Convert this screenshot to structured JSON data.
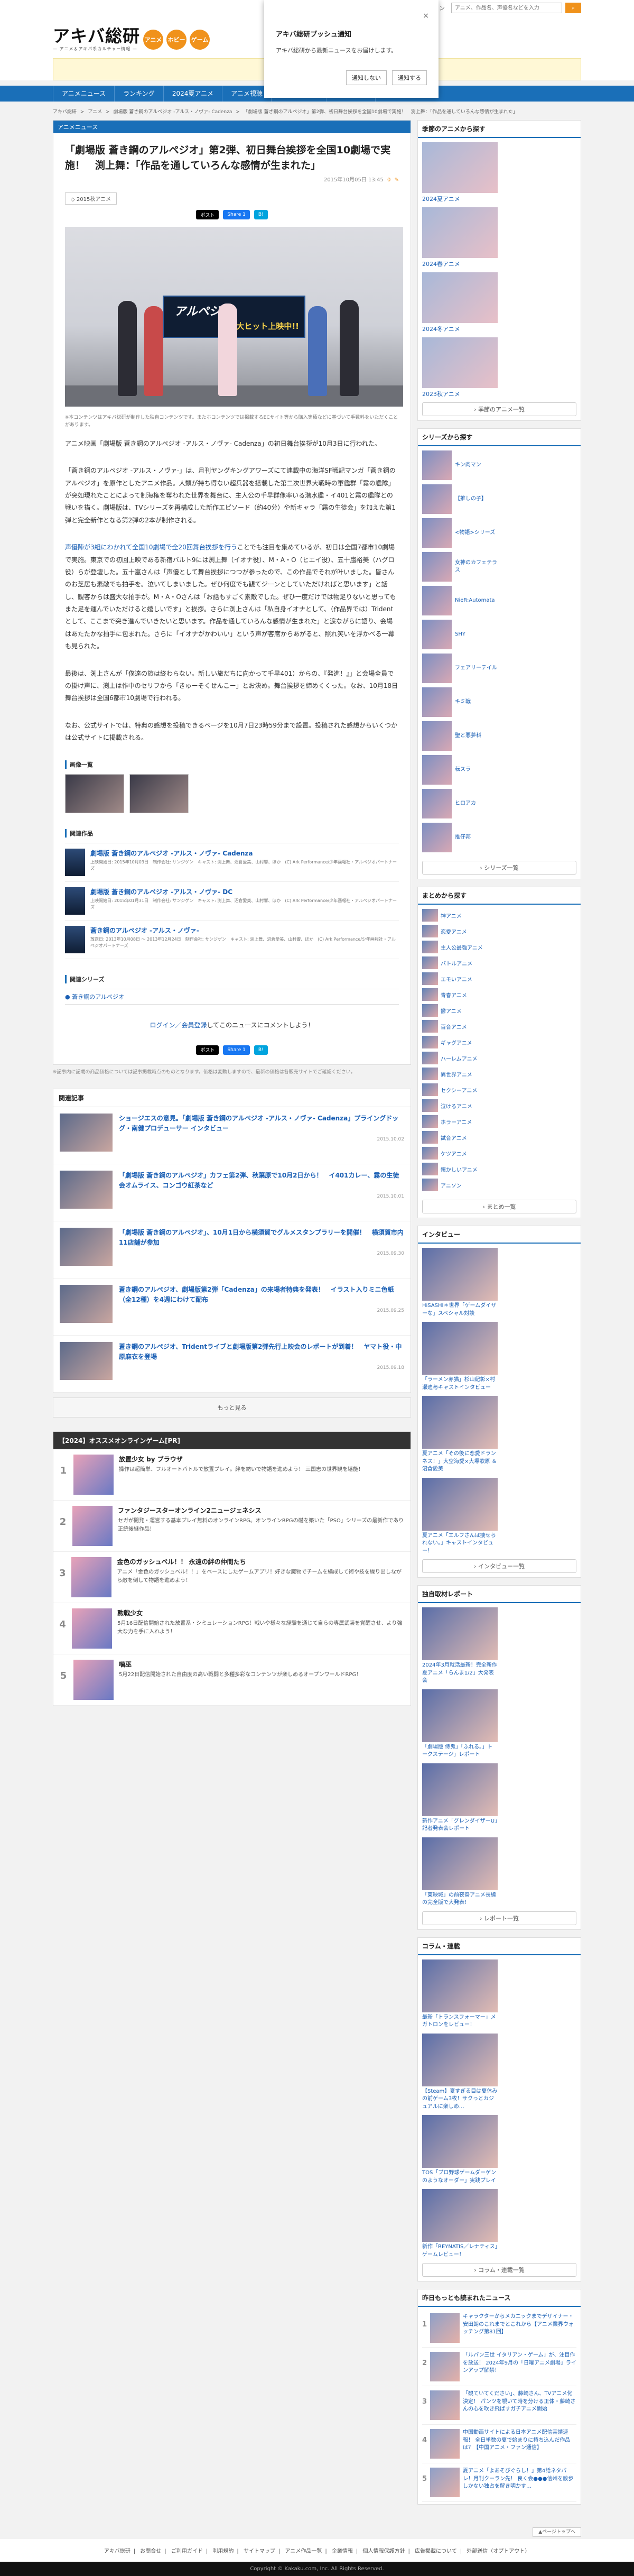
{
  "header": {
    "logo": "アキバ総研",
    "logo_sub": "— アニメ＆アキバ系カルチャー情報 —",
    "pills": [
      "アニメ",
      "ホビー",
      "ゲーム"
    ],
    "login": "ログイン",
    "search_placeholder": "アニメ、作品名、声優名などを入力",
    "search_button": "検索"
  },
  "push": {
    "title": "アキバ総研プッシュ通知",
    "body": "アキバ総研から最新ニュースをお届けします。",
    "deny": "通知しない",
    "allow": "通知する"
  },
  "nav": [
    "アニメニュース",
    "ランキング",
    "2024夏アニメ",
    "アニメ視聴",
    "声優ニュース",
    "アニメ映画"
  ],
  "breadcrumbs": [
    "アキバ総研",
    ">",
    "アニメ",
    ">",
    "劇場版 蒼き鋼のアルペジオ -アルス・ノヴァ- Cadenza",
    ">",
    "「劇場版 蒼き鋼のアルペジオ」第2弾、初日舞台挨拶を全国10劇場で実施！　渕上舞：「作品を通していろんな感情が生まれた」"
  ],
  "article": {
    "category": "アニメニュース",
    "title": "「劇場版 蒼き鋼のアルペジオ」第2弾、初日舞台挨拶を全国10劇場で実施！　渕上舞：「作品を通していろんな感情が生まれた」",
    "date": "2015年10月05日 13:45",
    "comments": "0",
    "tag": "2015秋アニメ",
    "share_x": "ポスト",
    "share_fb": "Share 1",
    "share_hb": "B!",
    "hero_logo": "アルペジオ",
    "hero_hit": "大ヒット上映中!!",
    "caption": "※本コンテンツはアキバ総研が制作した独自コンテンツです。またホコンテンツでは掲載するECサイト等から購入実績などに基づいて手数料をいただくことがあります。",
    "p1": "アニメ映画「劇場版 蒼き鋼のアルペジオ -アルス・ノヴァ- Cadenza」の初日舞台挨拶が10月3日に行われた。",
    "p2": "「蒼き鋼のアルペジオ -アルス・ノヴァ-」は、月刊ヤングキングアワーズにて連載中の海洋SF戦記マンガ「蒼き鋼のアルペジオ」を原作としたアニメ作品。人類が持ち得ない超兵器を搭載した第二次世界大戦時の軍艦群「霧の艦隊」が突如現れたことによって制海権を奪われた世界を舞台に、主人公の千早群像率いる潜水艦・イ401と霧の艦隊との戦いを描く。劇場版は、TVシリーズを再構成した新作エピソード（約40分）や新キャラ「霧の生徒会」を加えた第1弾と完全新作となる第2弾の2本が制作される。",
    "p3_link": "声優陣が3組にわかれて全国10劇場で全20回舞台挨拶を行う",
    "p3": "ことでも注目を集めているが、初日は全国7都市10劇場で実施。東京での初回上映である新宿バルト9には渕上舞（イオナ役）、M・A・O（ヒエイ役）、五十嵐裕美（ハグロ役）らが登壇した。五十嵐さんは「声優として舞台挨拶につつが参ったので、この作品でそれが叶いました。皆さんのお芝居も素敵でも拍手を。泣いてしまいました。ぜひ何度でも観てジーンとしていただければと思います」と話し、観客からは盛大な拍手が。M・A・Oさんは「お話もすごく素敵でした。ぜひ一度だけでは物足りないと思ってもまた足を運んでいただけると嬉しいです」と挨拶。さらに渕上さんは「私自身イオナとして、（作品界では）Tridentとして、ここまで突き進んでいきたいと思います。作品を通していろんな感情が生まれた」と涙ながらに語り、会場はあたたかな拍手に包まれた。さらに「イオナがかわいい」という声が客席からあがると、照れ笑いを浮かべる一幕も見られた。",
    "p4": "最後は、渕上さんが「僕達の旅は終わらない。新しい旅だちに向かって千早401）からの、『発進！』」と会場全員での掛け声に、渕上は作中のセリフから「きゅーそくせんこー」とお決め。舞台挨拶を締めくくった。なお、10月18日舞台挨拶は全国6都市10劇場で行われる。",
    "p5": "なお、公式サイトでは、特典の感想を投稿できるページを10月7日23時59分まで設置。投稿された感想からいくつかは公式サイトに掲載される。",
    "images_heading": "画像一覧",
    "works_heading": "関連作品",
    "works": [
      {
        "title": "劇場版 蒼き鋼のアルペジオ -アルス・ノヴァ- Cadenza",
        "meta": "上映開始日: 2015年10月03日　制作会社: サンジゲン　キャスト: 渕上舞、沼倉愛美、山村響、ほか　(C) Ark Performance/少年画報社・アルペジオパートナーズ"
      },
      {
        "title": "劇場版 蒼き鋼のアルペジオ -アルス・ノヴァ- DC",
        "meta": "上映開始日: 2015年01月31日　制作会社: サンジゲン　キャスト: 渕上舞、沼倉愛美、山村響、ほか　(C) Ark Performance/少年画報社・アルペジオパートナーズ"
      },
      {
        "title": "蒼き鋼のアルペジオ -アルス・ノヴァ-",
        "meta": "放送日: 2013年10月08日 ～ 2013年12月24日　制作会社: サンジゲン　キャスト: 渕上舞、沼倉愛美、山村響、ほか　(C) Ark Performance/少年画報社・アルペジオパートナーズ"
      }
    ],
    "series_heading": "関連シリーズ",
    "series_link": "蒼き鋼のアルペジオ",
    "login_link": "ログイン／会員登録",
    "login_rest": "してこのニュースにコメントしよう！",
    "foot_note": "※記事内に記載の商品価格については記事掲載時点のものとなります。価格は変動しますので、最新の価格は各販売サイトでご確認ください。"
  },
  "related": {
    "heading": "関連記事",
    "items": [
      {
        "title": "ショージエスの意見。「劇場版 蒼き鋼のアルペジオ -アルス・ノヴァ- Cadenza」プライングドッグ・南健プロデューサー インタビュー",
        "date": "2015.10.02"
      },
      {
        "title": "「劇場版 蒼き鋼のアルペジオ」カフェ第2弾、秋葉原で10月2日から！　イ401カレー、霧の生徒会オムライス、コンゴウ紅茶など",
        "date": "2015.10.01"
      },
      {
        "title": "「劇場版 蒼き鋼のアルペジオ」、10月1日から横須賀でグルメスタンプラリーを開催！　横須賀市内11店舗が参加",
        "date": "2015.09.30"
      },
      {
        "title": "蒼き鋼のアルペジオ、劇場版第2弾「Cadenza」の来場者特典を発表！　イラスト入りミニ色紙（全12種）を4週にわけて配布",
        "date": "2015.09.25"
      },
      {
        "title": "蒼き鋼のアルペジオ、Tridentライブと劇場版第2弾先行上映会のレポートが到着！　ヤマト役・中原麻衣を登場",
        "date": "2015.09.18"
      }
    ],
    "more": "もっと見る"
  },
  "games": {
    "heading": "【2024】オススメオンラインゲーム[PR]",
    "items": [
      {
        "num": "1",
        "name": "放置少女 by ブラウザ",
        "desc": "操作は超簡単、フルオートバトルで放置プレイ。絆を紡いで物語を進めよう！ 三国志の世界観を堪能！"
      },
      {
        "num": "2",
        "name": "ファンタジースターオンライン2ニュージェネシス",
        "desc": "セガが開発・運営する基本プレイ無料のオンラインRPG。オンラインRPGの礎を築いた「PSO」シリーズの最新作であり正統後継作品！"
      },
      {
        "num": "3",
        "name": "金色のガッシュベル！！ 永遠の絆の仲間たち",
        "desc": "アニメ「金色のガッシュベル！！」をベースにしたゲームアプリ！好きな魔物でチームを編成して術や技を繰り出しながら敵を倒して物語を進めよう！"
      },
      {
        "num": "4",
        "name": "勲戦少女",
        "desc": "5月16日配信開始された放置系・シミュレーションRPG！戦いや様々な経験を通じて自らの専属武装を覚醒させ、より強大な力を手に入れよう！"
      },
      {
        "num": "5",
        "name": "噛巫",
        "desc": "5月22日配信開始された自由度の高い戦闘と多種多彩なコンテンツが楽しめるオープンワールドRPG！"
      }
    ]
  },
  "sidebar": {
    "season": {
      "heading": "季節のアニメから探す",
      "items": [
        "2024夏アニメ",
        "2024春アニメ",
        "2024冬アニメ",
        "2023秋アニメ"
      ],
      "more": "季節のアニメ一覧"
    },
    "series": {
      "heading": "シリーズから探す",
      "items": [
        "キン肉マン",
        "【推しの子】",
        "<物語>シリーズ",
        "女神のカフェテラス",
        "NieR:Automata",
        "SHY",
        "フェアリーテイル",
        "キミ戦",
        "聖と悪夢科",
        "転スラ",
        "ヒロアカ",
        "推仔邦"
      ],
      "more": "シリーズ一覧"
    },
    "matome": {
      "heading": "まとめから探す",
      "items": [
        "神アニメ",
        "恋愛アニメ",
        "主人公最強アニメ",
        "バトルアニメ",
        "エモいアニメ",
        "青春アニメ",
        "鬱アニメ",
        "百合アニメ",
        "ギャグアニメ",
        "ハーレムアニメ",
        "異世界アニメ",
        "セクシーアニメ",
        "泣けるアニメ",
        "ホラーアニメ",
        "試合アニメ",
        "ケツアニメ",
        "懐かしいアニメ",
        "アニソン"
      ],
      "more": "まとめ一覧"
    },
    "interview": {
      "heading": "インタビュー",
      "items": [
        "HiSASHI＊世界「ゲームダイザーな」スペシャル対談",
        "「ラーメン赤猫」杉山紀彰×村瀬迪与キャストインタビュー",
        "夏アニメ「その後に恋愛ドランネス！」大空海愛×大塚歌原 ＆ 沼倉愛美",
        "夏アニメ「エルフさんは痩せられない。」キャストインタビュー！"
      ],
      "more": "インタビュー一覧"
    },
    "report": {
      "heading": "独自取材レポート",
      "items": [
        "2024年3月就活最新！完全新作夏アニメ「らんま1/2」大発表会",
        "「劇場版 侍鬼」「ふれる。」トークステージ」レポート",
        "新作アニメ「グレンダイザーU」記者発表会レポート",
        "「東映城」の前夜祭アニメ長編の完全版で大発表！"
      ],
      "more": "レポート一覧"
    },
    "column": {
      "heading": "コラム・連載",
      "items": [
        "最新「トランスフォーマー」メガトロンをレビュー！",
        "【Steam】夏すぎる目は夏休みの前ゲーム3枚！サクっとカジュアルに楽しめ…",
        "TOS「プロ野球ゲームダーゲンのようなオーダー」実践プレイ",
        "新作「REYNATIS／レナティス」ゲームレビュー！"
      ],
      "more": "コラム・連載一覧"
    },
    "ranking": {
      "heading": "昨日もっとも読まれたニュース",
      "items": [
        {
          "num": "1",
          "text": "キャラクターからメカニックまでデザイナー・安田朗のこれまでとこれから【アニメ業界ウォッチング第81回】"
        },
        {
          "num": "2",
          "text": "「ルパン三世 イタリアン・ゲーム」が、注目作を放送！ 2024年9月の「日曜アニメ劇場」ラインアップ解禁！"
        },
        {
          "num": "3",
          "text": "「観ていてください」、藤崎さん、TVアニメ化決定！ パンツを覗いて時を分ける正体・藤崎さんの心を吹き飛ばすガチアニメ開始"
        },
        {
          "num": "4",
          "text": "中国動画サイトによる日本アニメ配信実績速報！ 全日単数の夏で始まりに持ち込んだ作品は？【中国アニメ・ファン通信】"
        },
        {
          "num": "5",
          "text": "夏アニメ「よあそびぐらし！」第4話ネタバレ！月刊クーラン先！ 良く会●●●信州を散歩しかない独占を解き明かす…"
        }
      ]
    }
  },
  "pagetop": "▲ページトップへ",
  "footer": {
    "links": [
      "アキバ総研",
      "お問合せ",
      "ご利用ガイド",
      "利用規約",
      "サイトマップ",
      "アニメ作品一覧",
      "企業情報",
      "個人情報保護方針",
      "広告掲載について",
      "外部送信（オプトアウト）"
    ],
    "copyright": "Copyright © Kakaku.com, Inc. All Rights Reserved."
  }
}
